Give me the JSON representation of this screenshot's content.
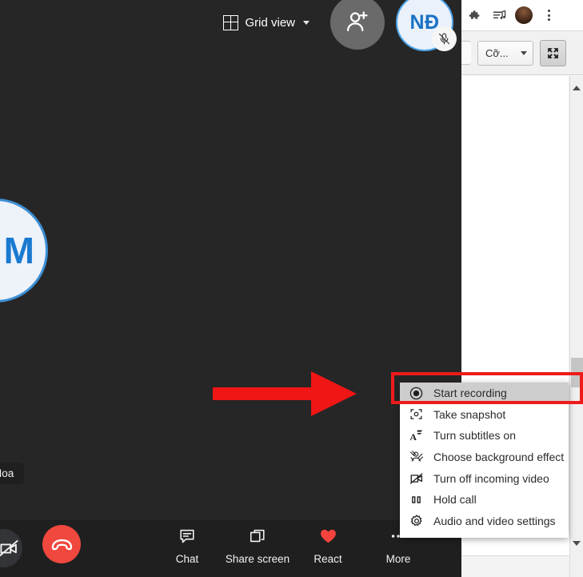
{
  "browser": {
    "chrome": {
      "extensions_icon": "puzzle-icon",
      "media_icon": "playlist-music-icon",
      "profile_icon": "profile-avatar",
      "menu_icon": "three-dots-menu-icon"
    },
    "toolbar": {
      "size_select_label": "Cỡ...",
      "size_select_caret": "chevron-down-icon",
      "fullscreen_icon": "fullscreen-icon"
    },
    "scrollbar": {
      "up_arrow": "scroll-up-arrow",
      "down_arrow": "scroll-down-arrow"
    }
  },
  "teams": {
    "topbar": {
      "grid_view_label": "Grid view",
      "grid_view_icon": "grid-icon",
      "grid_view_caret": "chevron-down-icon",
      "add_people_icon": "add-person-icon",
      "self_avatar_initials": "NĐ",
      "self_avatar_mic_icon": "microphone-muted-icon"
    },
    "stage": {
      "participant_initials": "M",
      "participant_name": "Moa"
    },
    "controls": {
      "camera_off_icon": "camera-off-icon",
      "hangup_icon": "hangup-phone-icon",
      "items": [
        {
          "label": "Chat",
          "icon": "chat-icon"
        },
        {
          "label": "Share screen",
          "icon": "share-screen-icon"
        },
        {
          "label": "React",
          "icon": "heart-icon"
        },
        {
          "label": "More",
          "icon": "more-icon"
        }
      ]
    }
  },
  "context_menu": {
    "items": [
      {
        "label": "Start recording",
        "icon": "record-circle-icon",
        "selected": true
      },
      {
        "label": "Take snapshot",
        "icon": "snapshot-icon",
        "selected": false
      },
      {
        "label": "Turn subtitles on",
        "icon": "subtitles-icon",
        "selected": false
      },
      {
        "label": "Choose background effect",
        "icon": "background-effect-icon",
        "selected": false
      },
      {
        "label": "Turn off incoming video",
        "icon": "video-off-icon",
        "selected": false
      },
      {
        "label": "Hold call",
        "icon": "pause-icon",
        "selected": false
      },
      {
        "label": "Audio and video settings",
        "icon": "gear-icon",
        "selected": false
      }
    ]
  },
  "annotations": {
    "arrow_icon": "red-arrow-pointing-right",
    "highlight_icon": "red-highlight-box",
    "accent_color": "#ef1b1b"
  }
}
